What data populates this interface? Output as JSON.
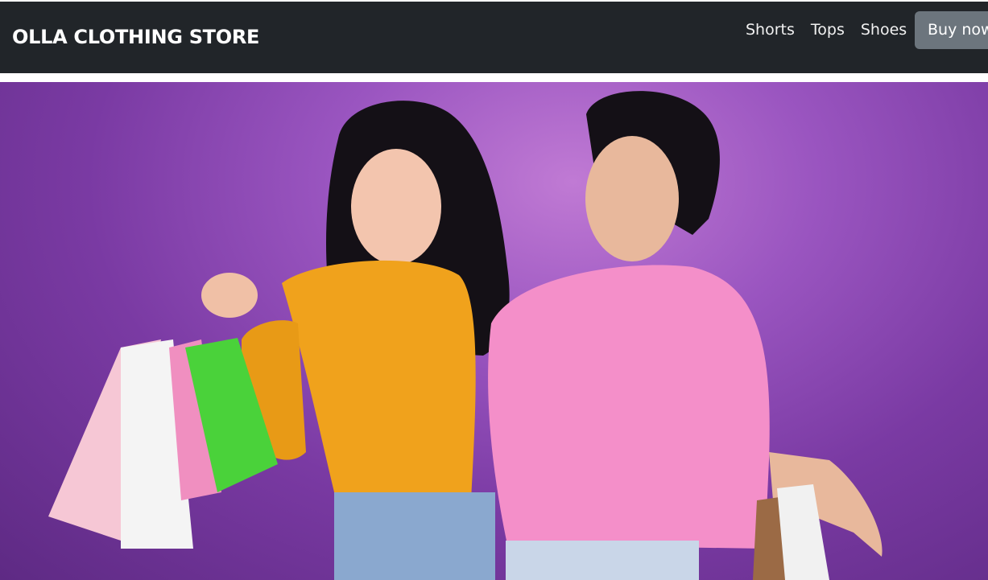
{
  "navbar": {
    "brand": "OLLA CLOTHING STORE",
    "links": [
      "Shorts",
      "Tops",
      "Shoes"
    ],
    "cta": "Buy now"
  },
  "hero": {
    "image": "two women holding shopping bags",
    "colors": {
      "background": "#8e4fb6",
      "left_top": "#f0a21c",
      "right_top": "#f48fc9"
    }
  },
  "colors": {
    "navbar": "#212529",
    "button": "#6c757d"
  }
}
